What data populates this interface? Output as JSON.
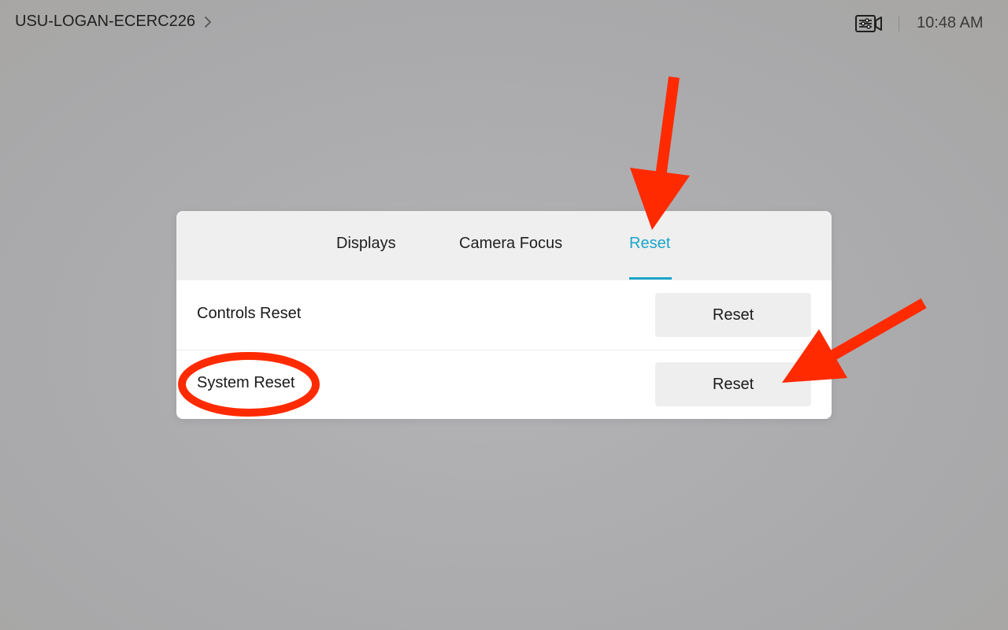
{
  "header": {
    "room_name": "USU-LOGAN-ECERC226",
    "time": "10:48 AM",
    "camera_icon": "camera-settings-icon",
    "chevron_icon": "chevron-right-icon"
  },
  "panel": {
    "tabs": [
      {
        "label": "Displays",
        "active": false
      },
      {
        "label": "Camera Focus",
        "active": false
      },
      {
        "label": "Reset",
        "active": true
      }
    ],
    "rows": [
      {
        "label": "Controls Reset",
        "button_label": "Reset"
      },
      {
        "label": "System Reset",
        "button_label": "Reset"
      }
    ]
  },
  "colors": {
    "accent": "#1aa5c9",
    "annotation": "#ff2a00"
  }
}
